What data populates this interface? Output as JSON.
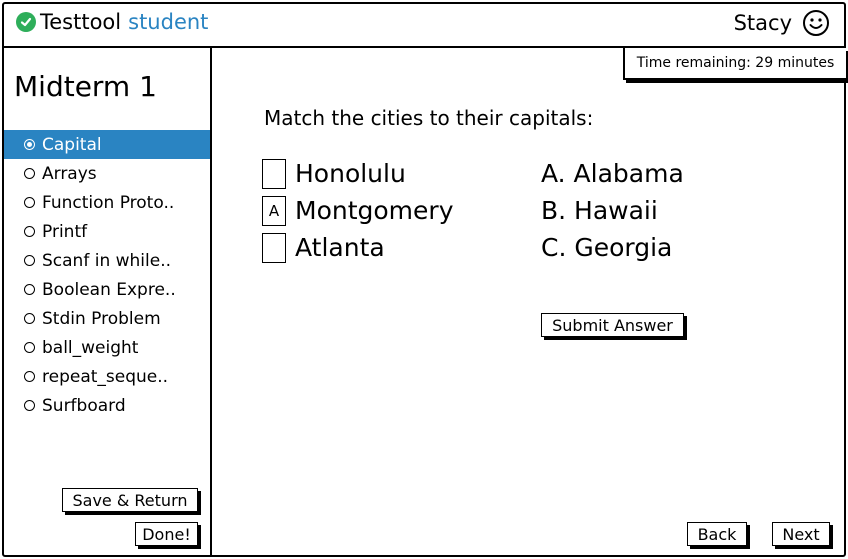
{
  "header": {
    "brand_name": "Testtool",
    "brand_accent": "student",
    "user_name": "Stacy",
    "accent_color": "#2a84c2",
    "check_color": "#2eae5a"
  },
  "sidebar": {
    "exam_title": "Midterm 1",
    "items": [
      {
        "label": "Capital",
        "selected": true
      },
      {
        "label": "Arrays",
        "selected": false
      },
      {
        "label": "Function Proto..",
        "selected": false
      },
      {
        "label": "Printf",
        "selected": false
      },
      {
        "label": "Scanf in while..",
        "selected": false
      },
      {
        "label": "Boolean Expre..",
        "selected": false
      },
      {
        "label": "Stdin Problem",
        "selected": false
      },
      {
        "label": "ball_weight",
        "selected": false
      },
      {
        "label": "repeat_seque..",
        "selected": false
      },
      {
        "label": "Surfboard",
        "selected": false
      }
    ],
    "save_return_label": "Save & Return",
    "done_label": "Done!"
  },
  "timer": {
    "text": "Time remaining: 29 minutes"
  },
  "question": {
    "prompt": "Match the cities to their capitals:",
    "cities": [
      {
        "name": "Honolulu",
        "answer": ""
      },
      {
        "name": "Montgomery",
        "answer": "A"
      },
      {
        "name": "Atlanta",
        "answer": ""
      }
    ],
    "states": [
      "A. Alabama",
      "B. Hawaii",
      "C. Georgia"
    ],
    "submit_label": "Submit Answer"
  },
  "footer": {
    "back_label": "Back",
    "next_label": "Next"
  }
}
